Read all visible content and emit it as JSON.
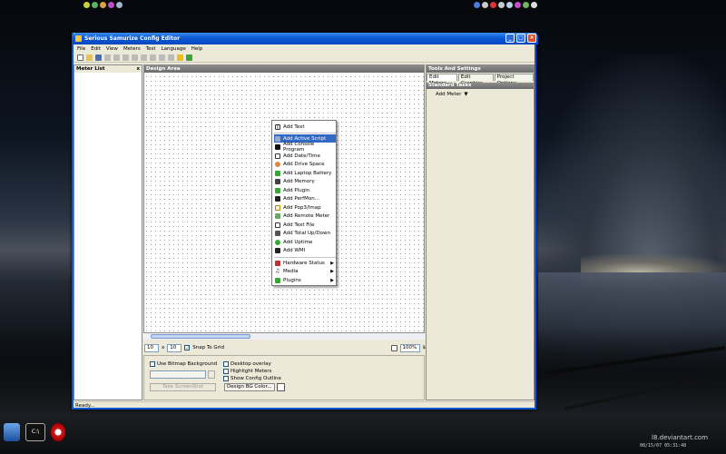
{
  "window": {
    "title": "Serious Samurize Config Editor",
    "menus": [
      "File",
      "Edit",
      "View",
      "Meters",
      "Test",
      "Language",
      "Help"
    ],
    "status": "Ready..."
  },
  "panels": {
    "meter_list": "Meter List",
    "meter_list_close": "x",
    "design_area": "Design Area",
    "tools": "Tools And Settings"
  },
  "tabs": [
    "Edit Meters",
    "Edit Graphics",
    "Project Options"
  ],
  "standard_tasks": {
    "header": "Standard Tasks",
    "add_meter": "Add Meter"
  },
  "grid": {
    "x": "10",
    "x_sep": "x",
    "y": "10",
    "snap_label": "Snap To Grid",
    "zoom": "100%",
    "zoom_btn": "$"
  },
  "bottom": {
    "use_bitmap": "Use Bitmap Background",
    "take_screenshot": "Take ScreenShot",
    "desktop_overlay": "Desktop overlay",
    "highlight_meters": "Highlight Meters",
    "show_outline": "Show Config Outline",
    "design_bg": "Design BG Color..."
  },
  "context_menu": {
    "top": "Add Text",
    "items": [
      "Add Active Script",
      "Add Console Program",
      "Add Date/Time",
      "Add Drive Space",
      "Add Laptop Battery",
      "Add Memory",
      "Add Plugin",
      "Add PerfMon...",
      "Add Pop3/Imap",
      "Add Remote Meter",
      "Add Text File",
      "Add Total Up/Down",
      "Add Uptime",
      "Add WMI"
    ],
    "submenus": [
      "Hardware Status",
      "Media",
      "Plugins"
    ],
    "highlighted": "Add Active Script"
  },
  "desktop": {
    "signature": "l8.deviantart.com",
    "datetime": "08/15/07 05:31:48"
  },
  "colors": {
    "titlebar": "#0a58d4",
    "menu_highlight": "#316ac5",
    "panel_header": "#7b7b7b",
    "window_bg": "#ece9d8"
  }
}
